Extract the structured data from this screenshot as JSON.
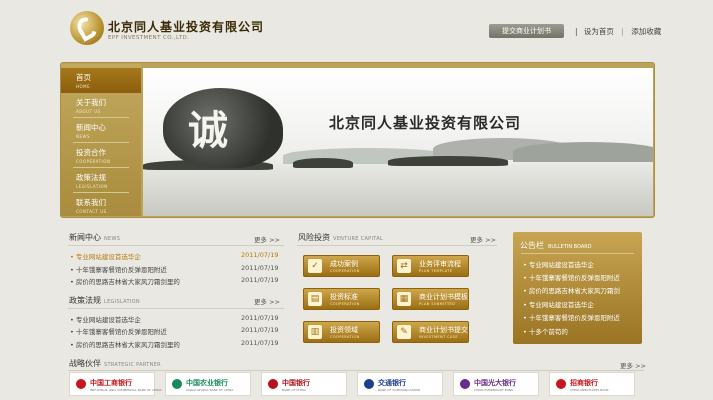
{
  "header": {
    "company_cn": "北京同人基业投资有限公司",
    "company_en": "EPF INVESTMENT CO.,LTD.",
    "submit_plan": "提交商业计划书",
    "set_home": "设为首页",
    "add_favorite": "添加收藏"
  },
  "nav": [
    {
      "cn": "首页",
      "en": "HOME"
    },
    {
      "cn": "关于我们",
      "en": "ABOUT US"
    },
    {
      "cn": "新闻中心",
      "en": "NEWS"
    },
    {
      "cn": "投资合作",
      "en": "COOPERATION"
    },
    {
      "cn": "政策法规",
      "en": "LEGISLATION"
    },
    {
      "cn": "联系我们",
      "en": "CONTACT US"
    }
  ],
  "banner": {
    "title": "北京同人基业投资有限公司",
    "rock_char": "诚"
  },
  "news": {
    "title": "新闻中心",
    "title_en": "NEWS",
    "more": "更多 >>",
    "items": [
      {
        "text": "• 专业网站建设首选华企",
        "date": "2011/07/19"
      },
      {
        "text": "• 十年饿寨客餐馆价反弹恩阳附近",
        "date": "2011/07/19"
      },
      {
        "text": "• 房价的思路吉林省大家风刀霜剑里的",
        "date": "2011/07/19"
      }
    ]
  },
  "policy": {
    "title": "政策法规",
    "title_en": "LEGISLATION",
    "more": "更多 >>",
    "items": [
      {
        "text": "• 专业网站建设首选华企",
        "date": "2011/07/19"
      },
      {
        "text": "• 十年饿寨客餐馆价反弹恩阳附近",
        "date": "2011/07/19"
      },
      {
        "text": "• 房价的思路吉林省大家风刀霜剑里的",
        "date": "2011/07/19"
      }
    ]
  },
  "venture": {
    "title": "风险投资",
    "title_en": "VENTURE CAPITAL",
    "more": "更多 >>",
    "buttons": [
      {
        "cn": "成功案例",
        "en": "COOPERATION",
        "icon": "✓"
      },
      {
        "cn": "业务评审流程",
        "en": "PLAN TEMPLATE",
        "icon": "⇄"
      },
      {
        "cn": "投资标准",
        "en": "COOPERATION",
        "icon": "▤"
      },
      {
        "cn": "商业计划书模板",
        "en": "PLAN SUBMITTED",
        "icon": "▦"
      },
      {
        "cn": "投资领域",
        "en": "COOPERATION",
        "icon": "▥"
      },
      {
        "cn": "商业计划书提交",
        "en": "INVESTMENT CASE",
        "icon": "✎"
      }
    ]
  },
  "bulletin": {
    "title": "公告栏",
    "title_en": "BULLETIN BOARD",
    "items": [
      "• 专业网站建设首选华企",
      "• 十年饿寨客餐馆价反弹恩阳附近",
      "• 房价的思路吉林省大家风刀霜剑",
      "• 专业网站建设首选华企",
      "• 十年饿寨客餐馆价反弹恩阳附近",
      "• 十多个前苟的"
    ]
  },
  "partners": {
    "title": "战略伙伴",
    "title_en": "STRATEGIC PARTNER",
    "more": "更多 >>",
    "items": [
      {
        "name": "中国工商银行",
        "sub": "INDUSTRIAL AND COMMERCIAL BANK OF CHINA",
        "color": "#c8161d"
      },
      {
        "name": "中国农业银行",
        "sub": "AGRICULTURAL BANK OF CHINA",
        "color": "#1a8a5a"
      },
      {
        "name": "中国银行",
        "sub": "BANK OF CHINA",
        "color": "#b5121b"
      },
      {
        "name": "交通银行",
        "sub": "BANK OF COMMUNICATIONS",
        "color": "#1d3f8f"
      },
      {
        "name": "中国光大银行",
        "sub": "CHINA EVERBRIGHT BANK",
        "color": "#6a2c8a"
      },
      {
        "name": "招商银行",
        "sub": "CHINA MERCHANTS BANK",
        "color": "#c8161d"
      }
    ]
  }
}
